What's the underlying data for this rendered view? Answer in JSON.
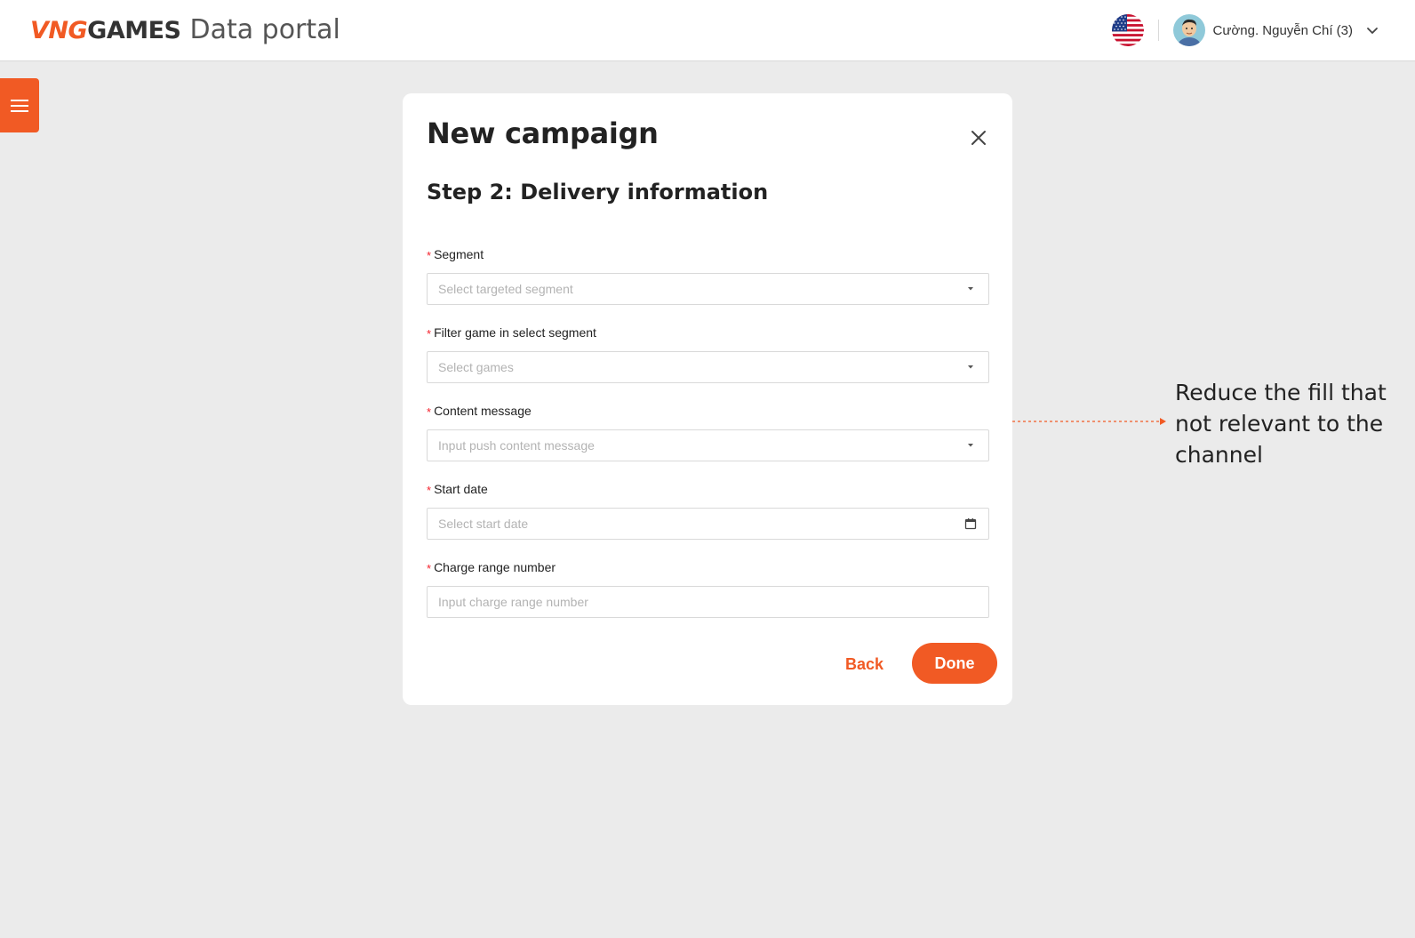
{
  "header": {
    "logo_accent": "VNG",
    "logo_rest": "GAMES",
    "portal_title": "Data portal",
    "language_icon": "us-flag-icon",
    "user_name": "Cường. Nguyễn Chí (3)"
  },
  "colors": {
    "brand": "#f15a24",
    "required": "#f5222d",
    "background": "#ebebeb"
  },
  "modal": {
    "title": "New campaign",
    "step_title": "Step 2: Delivery information",
    "fields": [
      {
        "label": "Segment",
        "placeholder": "Select targeted segment",
        "type": "select",
        "required": "*"
      },
      {
        "label": "Filter game in select segment",
        "placeholder": "Select games",
        "type": "select",
        "required": "*"
      },
      {
        "label": "Content message",
        "placeholder": "Input push content message",
        "type": "select",
        "required": "*"
      },
      {
        "label": "Start date",
        "placeholder": "Select start date",
        "type": "date",
        "required": "*"
      },
      {
        "label": "Charge range number",
        "placeholder": "Input charge range number",
        "type": "text",
        "required": "*"
      }
    ],
    "back_label": "Back",
    "done_label": "Done"
  },
  "annotation": {
    "text": "Reduce the fill that not relevant to the channel"
  }
}
